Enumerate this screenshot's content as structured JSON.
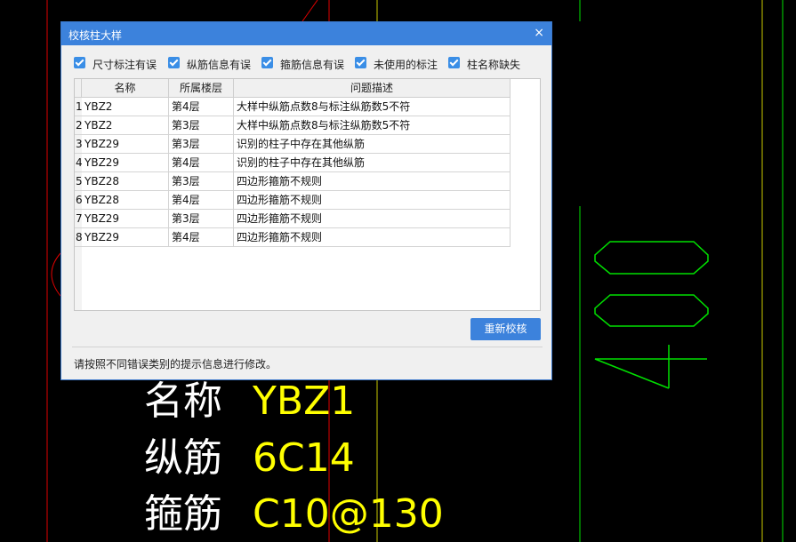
{
  "dialog": {
    "title": "校核柱大样",
    "close_glyph": "×",
    "filters": [
      {
        "label": "尺寸标注有误",
        "checked": true
      },
      {
        "label": "纵筋信息有误",
        "checked": true
      },
      {
        "label": "箍筋信息有误",
        "checked": true
      },
      {
        "label": "未使用的标注",
        "checked": true
      },
      {
        "label": "柱名称缺失",
        "checked": true
      }
    ],
    "table": {
      "headers": [
        "名称",
        "所属楼层",
        "问题描述"
      ],
      "rows": [
        {
          "num": "1",
          "name": "YBZ2",
          "floor": "第4层",
          "desc": "大样中纵筋点数8与标注纵筋数5不符"
        },
        {
          "num": "2",
          "name": "YBZ2",
          "floor": "第3层",
          "desc": "大样中纵筋点数8与标注纵筋数5不符"
        },
        {
          "num": "3",
          "name": "YBZ29",
          "floor": "第3层",
          "desc": "识别的柱子中存在其他纵筋"
        },
        {
          "num": "4",
          "name": "YBZ29",
          "floor": "第4层",
          "desc": "识别的柱子中存在其他纵筋"
        },
        {
          "num": "5",
          "name": "YBZ28",
          "floor": "第3层",
          "desc": "四边形箍筋不规则"
        },
        {
          "num": "6",
          "name": "YBZ28",
          "floor": "第4层",
          "desc": "四边形箍筋不规则"
        },
        {
          "num": "7",
          "name": "YBZ29",
          "floor": "第3层",
          "desc": "四边形箍筋不规则"
        },
        {
          "num": "8",
          "name": "YBZ29",
          "floor": "第4层",
          "desc": "四边形箍筋不规则"
        }
      ]
    },
    "recheck_label": "重新校核",
    "hint": "请按照不同错误类别的提示信息进行修改。"
  },
  "cad": {
    "dimension_text": "400",
    "labels": [
      {
        "key": "名称",
        "value": "YBZ1"
      },
      {
        "key": "纵筋",
        "value": "6C14"
      },
      {
        "key": "箍筋",
        "value": "C10@130"
      }
    ],
    "colors": {
      "white": "#ffffff",
      "yellow": "#ffff00",
      "green": "#00e000",
      "red": "#e00000",
      "accent": "#3c82dc"
    }
  }
}
